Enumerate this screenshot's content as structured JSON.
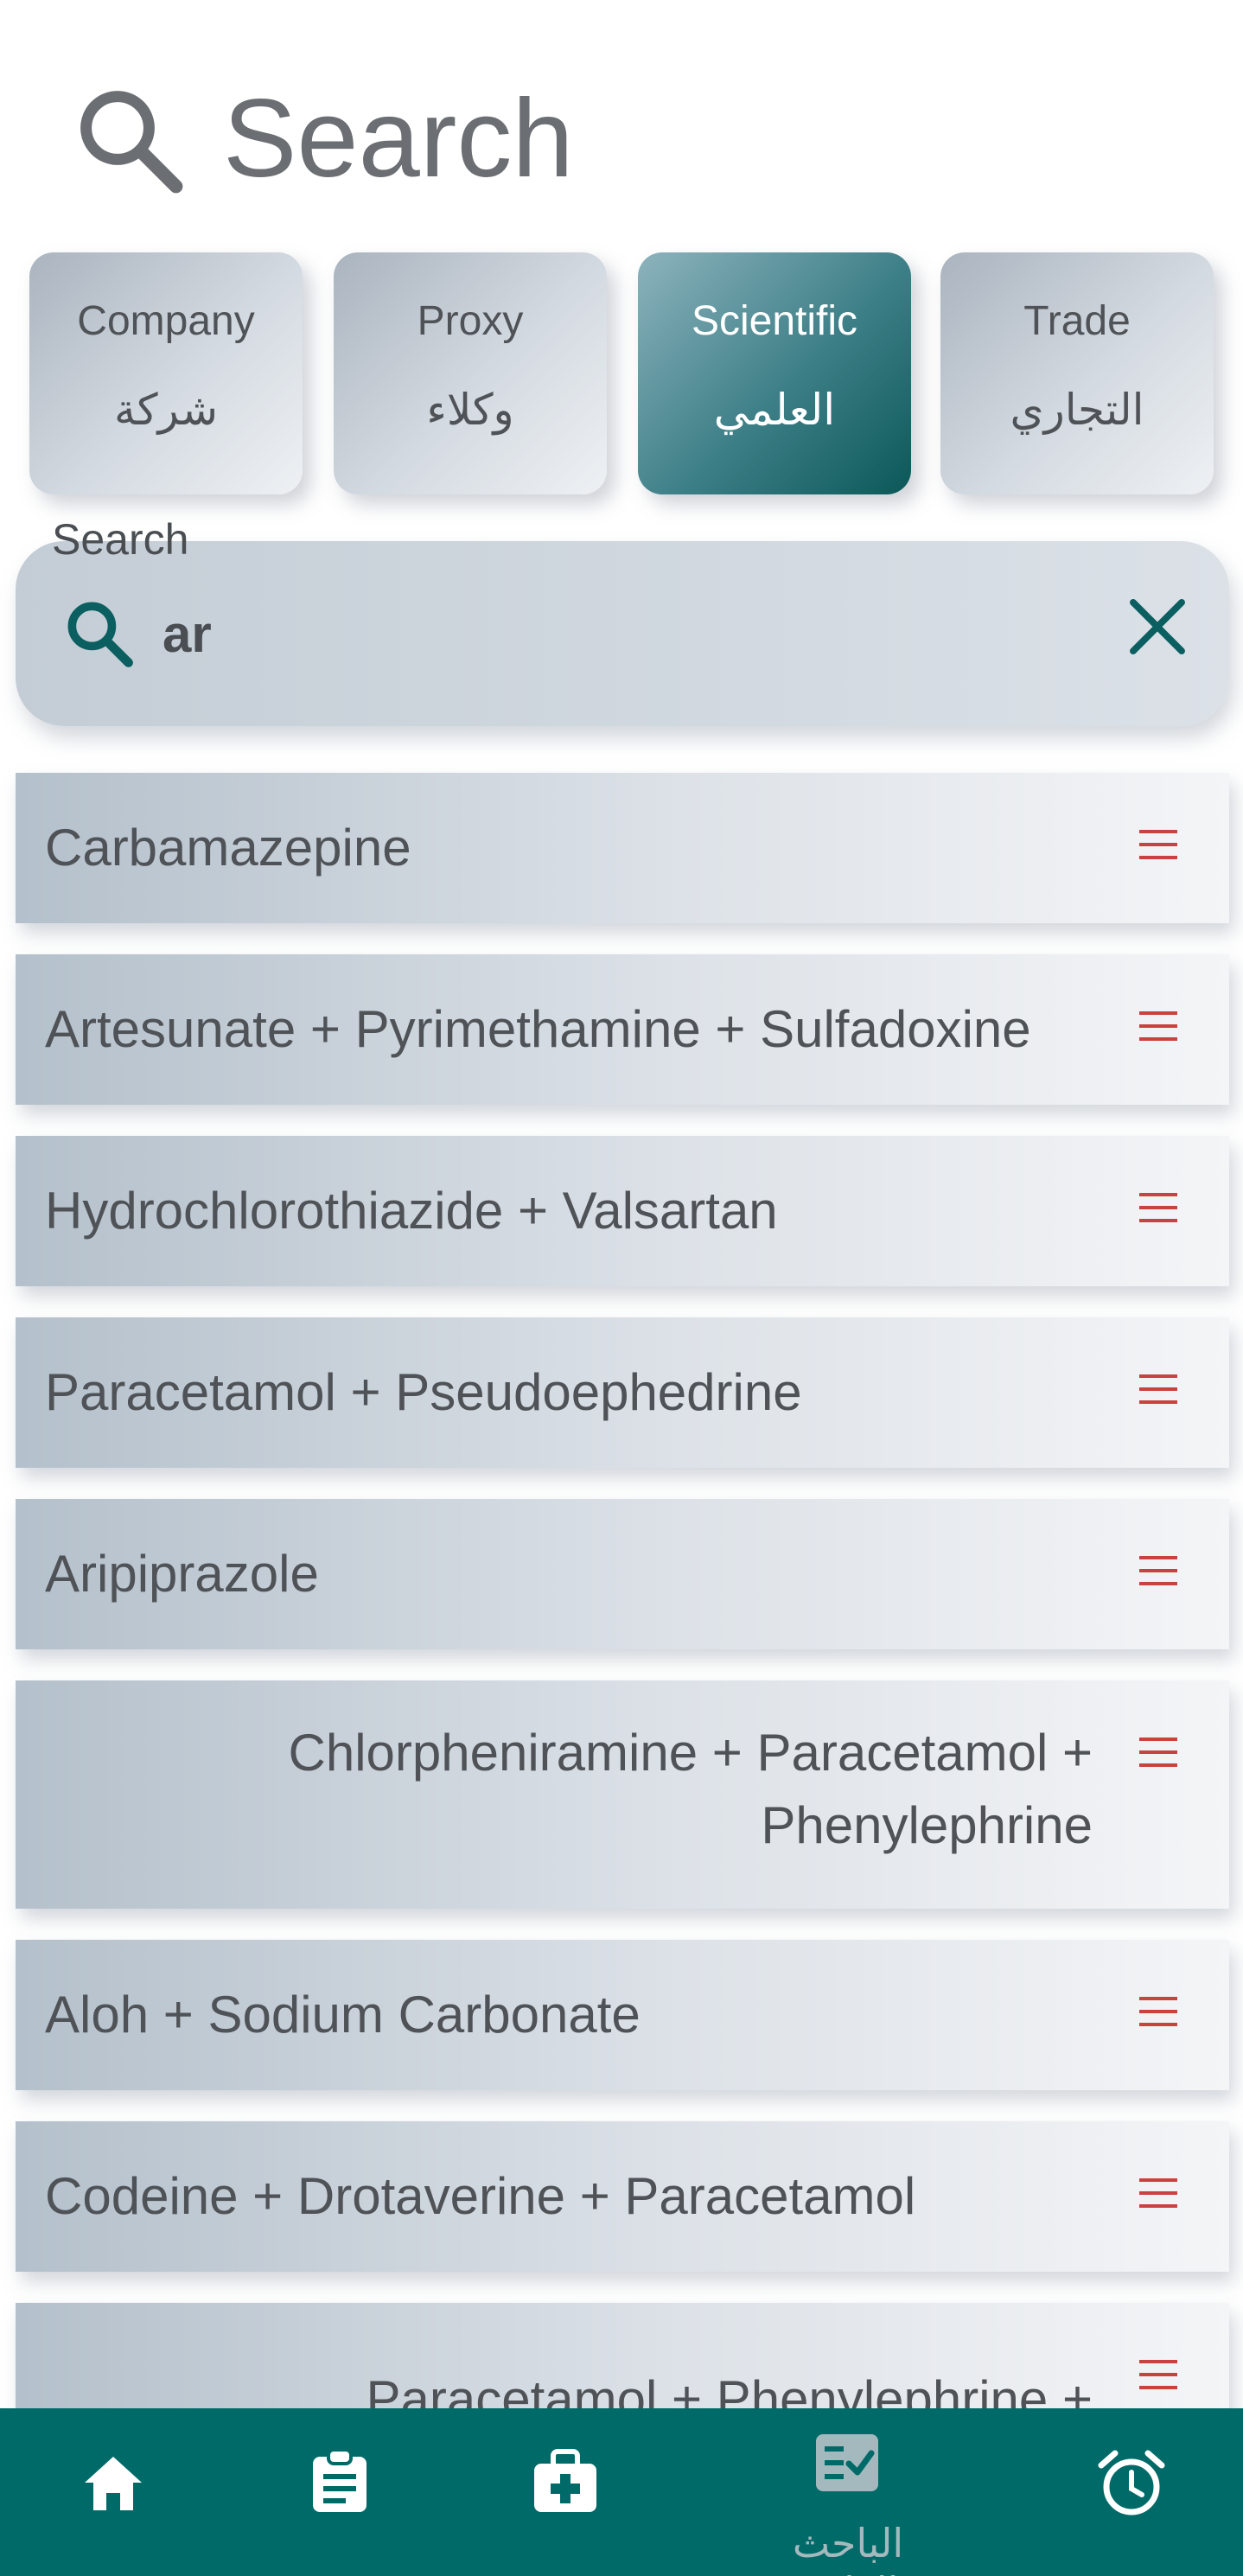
{
  "header": {
    "title": "Search",
    "icon": "search-icon"
  },
  "tabs": [
    {
      "en": "Company",
      "ar": "شركة",
      "active": false
    },
    {
      "en": "Proxy",
      "ar": "وكلاء",
      "active": false
    },
    {
      "en": "Scientific",
      "ar": "العلمي",
      "active": true
    },
    {
      "en": "Trade",
      "ar": "التجاري",
      "active": false
    }
  ],
  "search": {
    "label": "Search",
    "value": "ar"
  },
  "results": [
    {
      "name": "Carbamazepine"
    },
    {
      "name": "Artesunate + Pyrimethamine + Sulfadoxine"
    },
    {
      "name": "Hydrochlorothiazide + Valsartan"
    },
    {
      "name": "Paracetamol + Pseudoephedrine"
    },
    {
      "name": "Aripiprazole"
    },
    {
      "name": "Chlorpheniramine + Paracetamol + Phenylephrine"
    },
    {
      "name": "Aloh + Sodium Carbonate"
    },
    {
      "name": "Codeine + Drotaverine + Paracetamol"
    },
    {
      "name": "Paracetamol + Phenylephrine +"
    }
  ],
  "bottom_nav": {
    "items": [
      {
        "icon": "home-icon"
      },
      {
        "icon": "clipboard-icon"
      },
      {
        "icon": "medical-kit-icon"
      },
      {
        "icon": "checklist-icon",
        "label": "الباحث الطبي",
        "active": true
      },
      {
        "icon": "alarm-clock-icon"
      }
    ]
  },
  "colors": {
    "accent": "#006a69",
    "menu_icon": "#c8423f",
    "text": "#4f5357"
  }
}
